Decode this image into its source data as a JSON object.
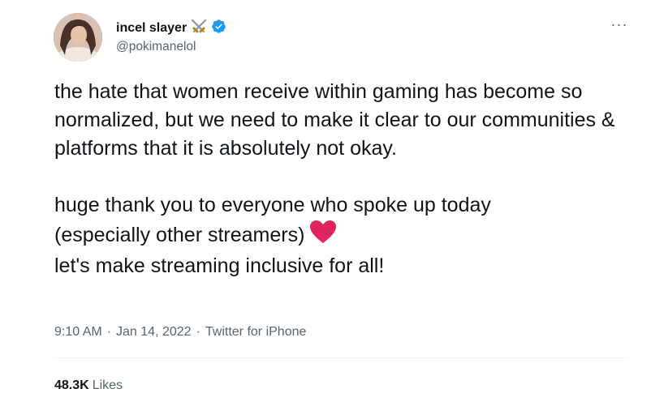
{
  "author": {
    "display_name": "incel slayer",
    "name_emoji": "crossed-swords-icon",
    "verified": true,
    "handle": "@pokimanelol"
  },
  "tweet": {
    "paragraph1": "the hate that women receive within gaming has become so normalized, but we need to make it clear to our communities & platforms that it is absolutely not okay.",
    "paragraph2_line1": "huge thank you to everyone who spoke up today",
    "paragraph2_line2": "(especially other streamers)",
    "paragraph2_emoji": "red-heart-icon",
    "paragraph2_line3": "let's make streaming inclusive for all!"
  },
  "meta": {
    "time": "9:10 AM",
    "separator": "·",
    "date": "Jan 14, 2022",
    "source": "Twitter for iPhone"
  },
  "stats": {
    "likes_count": "48.3K",
    "likes_label": "Likes"
  },
  "colors": {
    "text": "#0f1419",
    "secondary": "#536471",
    "verified": "#1d9bf0",
    "heart": "#e0245e",
    "divider": "#eff3f4"
  }
}
